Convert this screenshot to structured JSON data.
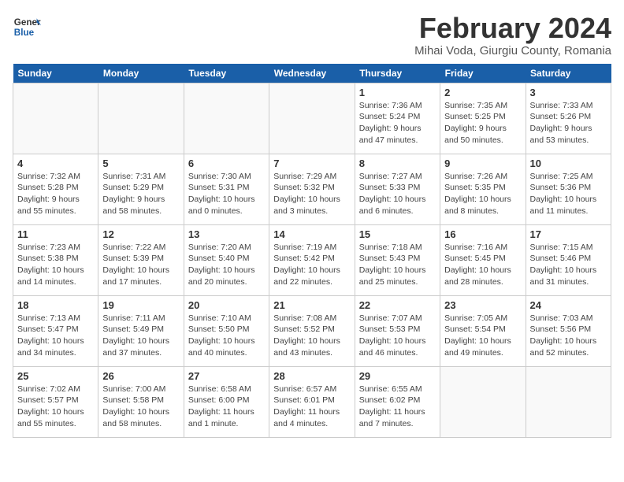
{
  "header": {
    "logo_line1": "General",
    "logo_line2": "Blue",
    "month": "February 2024",
    "location": "Mihai Voda, Giurgiu County, Romania"
  },
  "weekdays": [
    "Sunday",
    "Monday",
    "Tuesday",
    "Wednesday",
    "Thursday",
    "Friday",
    "Saturday"
  ],
  "weeks": [
    [
      {
        "day": "",
        "info": ""
      },
      {
        "day": "",
        "info": ""
      },
      {
        "day": "",
        "info": ""
      },
      {
        "day": "",
        "info": ""
      },
      {
        "day": "1",
        "info": "Sunrise: 7:36 AM\nSunset: 5:24 PM\nDaylight: 9 hours\nand 47 minutes."
      },
      {
        "day": "2",
        "info": "Sunrise: 7:35 AM\nSunset: 5:25 PM\nDaylight: 9 hours\nand 50 minutes."
      },
      {
        "day": "3",
        "info": "Sunrise: 7:33 AM\nSunset: 5:26 PM\nDaylight: 9 hours\nand 53 minutes."
      }
    ],
    [
      {
        "day": "4",
        "info": "Sunrise: 7:32 AM\nSunset: 5:28 PM\nDaylight: 9 hours\nand 55 minutes."
      },
      {
        "day": "5",
        "info": "Sunrise: 7:31 AM\nSunset: 5:29 PM\nDaylight: 9 hours\nand 58 minutes."
      },
      {
        "day": "6",
        "info": "Sunrise: 7:30 AM\nSunset: 5:31 PM\nDaylight: 10 hours\nand 0 minutes."
      },
      {
        "day": "7",
        "info": "Sunrise: 7:29 AM\nSunset: 5:32 PM\nDaylight: 10 hours\nand 3 minutes."
      },
      {
        "day": "8",
        "info": "Sunrise: 7:27 AM\nSunset: 5:33 PM\nDaylight: 10 hours\nand 6 minutes."
      },
      {
        "day": "9",
        "info": "Sunrise: 7:26 AM\nSunset: 5:35 PM\nDaylight: 10 hours\nand 8 minutes."
      },
      {
        "day": "10",
        "info": "Sunrise: 7:25 AM\nSunset: 5:36 PM\nDaylight: 10 hours\nand 11 minutes."
      }
    ],
    [
      {
        "day": "11",
        "info": "Sunrise: 7:23 AM\nSunset: 5:38 PM\nDaylight: 10 hours\nand 14 minutes."
      },
      {
        "day": "12",
        "info": "Sunrise: 7:22 AM\nSunset: 5:39 PM\nDaylight: 10 hours\nand 17 minutes."
      },
      {
        "day": "13",
        "info": "Sunrise: 7:20 AM\nSunset: 5:40 PM\nDaylight: 10 hours\nand 20 minutes."
      },
      {
        "day": "14",
        "info": "Sunrise: 7:19 AM\nSunset: 5:42 PM\nDaylight: 10 hours\nand 22 minutes."
      },
      {
        "day": "15",
        "info": "Sunrise: 7:18 AM\nSunset: 5:43 PM\nDaylight: 10 hours\nand 25 minutes."
      },
      {
        "day": "16",
        "info": "Sunrise: 7:16 AM\nSunset: 5:45 PM\nDaylight: 10 hours\nand 28 minutes."
      },
      {
        "day": "17",
        "info": "Sunrise: 7:15 AM\nSunset: 5:46 PM\nDaylight: 10 hours\nand 31 minutes."
      }
    ],
    [
      {
        "day": "18",
        "info": "Sunrise: 7:13 AM\nSunset: 5:47 PM\nDaylight: 10 hours\nand 34 minutes."
      },
      {
        "day": "19",
        "info": "Sunrise: 7:11 AM\nSunset: 5:49 PM\nDaylight: 10 hours\nand 37 minutes."
      },
      {
        "day": "20",
        "info": "Sunrise: 7:10 AM\nSunset: 5:50 PM\nDaylight: 10 hours\nand 40 minutes."
      },
      {
        "day": "21",
        "info": "Sunrise: 7:08 AM\nSunset: 5:52 PM\nDaylight: 10 hours\nand 43 minutes."
      },
      {
        "day": "22",
        "info": "Sunrise: 7:07 AM\nSunset: 5:53 PM\nDaylight: 10 hours\nand 46 minutes."
      },
      {
        "day": "23",
        "info": "Sunrise: 7:05 AM\nSunset: 5:54 PM\nDaylight: 10 hours\nand 49 minutes."
      },
      {
        "day": "24",
        "info": "Sunrise: 7:03 AM\nSunset: 5:56 PM\nDaylight: 10 hours\nand 52 minutes."
      }
    ],
    [
      {
        "day": "25",
        "info": "Sunrise: 7:02 AM\nSunset: 5:57 PM\nDaylight: 10 hours\nand 55 minutes."
      },
      {
        "day": "26",
        "info": "Sunrise: 7:00 AM\nSunset: 5:58 PM\nDaylight: 10 hours\nand 58 minutes."
      },
      {
        "day": "27",
        "info": "Sunrise: 6:58 AM\nSunset: 6:00 PM\nDaylight: 11 hours\nand 1 minute."
      },
      {
        "day": "28",
        "info": "Sunrise: 6:57 AM\nSunset: 6:01 PM\nDaylight: 11 hours\nand 4 minutes."
      },
      {
        "day": "29",
        "info": "Sunrise: 6:55 AM\nSunset: 6:02 PM\nDaylight: 11 hours\nand 7 minutes."
      },
      {
        "day": "",
        "info": ""
      },
      {
        "day": "",
        "info": ""
      }
    ]
  ]
}
